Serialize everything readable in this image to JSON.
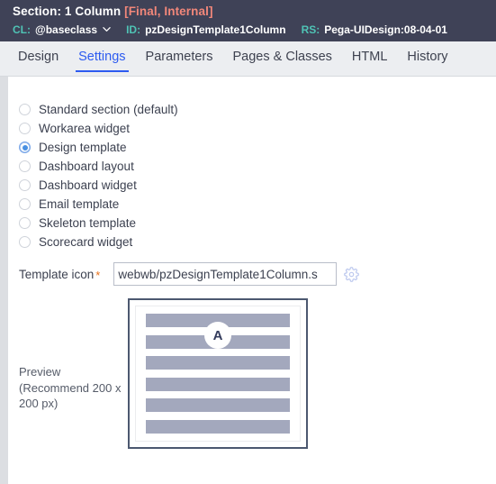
{
  "header": {
    "title_prefix": "Section:",
    "title_name": "1 Column",
    "title_flags": "[Final, Internal]",
    "cl_label": "CL:",
    "cl_value": "@baseclass",
    "id_label": "ID:",
    "id_value": "pzDesignTemplate1Column",
    "rs_label": "RS:",
    "rs_value": "Pega-UIDesign:08-04-01",
    "bg_color": "#3f4257",
    "key_color": "#4fc3b5",
    "flag_color": "#f2877a"
  },
  "tabs": {
    "active_index": 1,
    "accent_color": "#2d5bf0",
    "items": [
      {
        "label": "Design"
      },
      {
        "label": "Settings"
      },
      {
        "label": "Parameters"
      },
      {
        "label": "Pages & Classes"
      },
      {
        "label": "HTML"
      },
      {
        "label": "History"
      }
    ]
  },
  "section_type": {
    "selected_index": 2,
    "options": [
      {
        "label": "Standard section (default)"
      },
      {
        "label": "Workarea widget"
      },
      {
        "label": "Design template"
      },
      {
        "label": "Dashboard layout"
      },
      {
        "label": "Dashboard widget"
      },
      {
        "label": "Email template"
      },
      {
        "label": "Skeleton template"
      },
      {
        "label": "Scorecard widget"
      }
    ]
  },
  "template_icon": {
    "label": "Template icon",
    "required_marker": "*",
    "value": "webwb/pzDesignTemplate1Column.s",
    "placeholder": "",
    "gear_icon": "gear-icon"
  },
  "preview": {
    "label_line1": "Preview",
    "label_line2": "(Recommend 200 x",
    "label_line3": "200 px)",
    "badge_text": "A",
    "bar_count": 6,
    "bar_color": "#a3a8bd",
    "border_color": "#4c5870"
  }
}
